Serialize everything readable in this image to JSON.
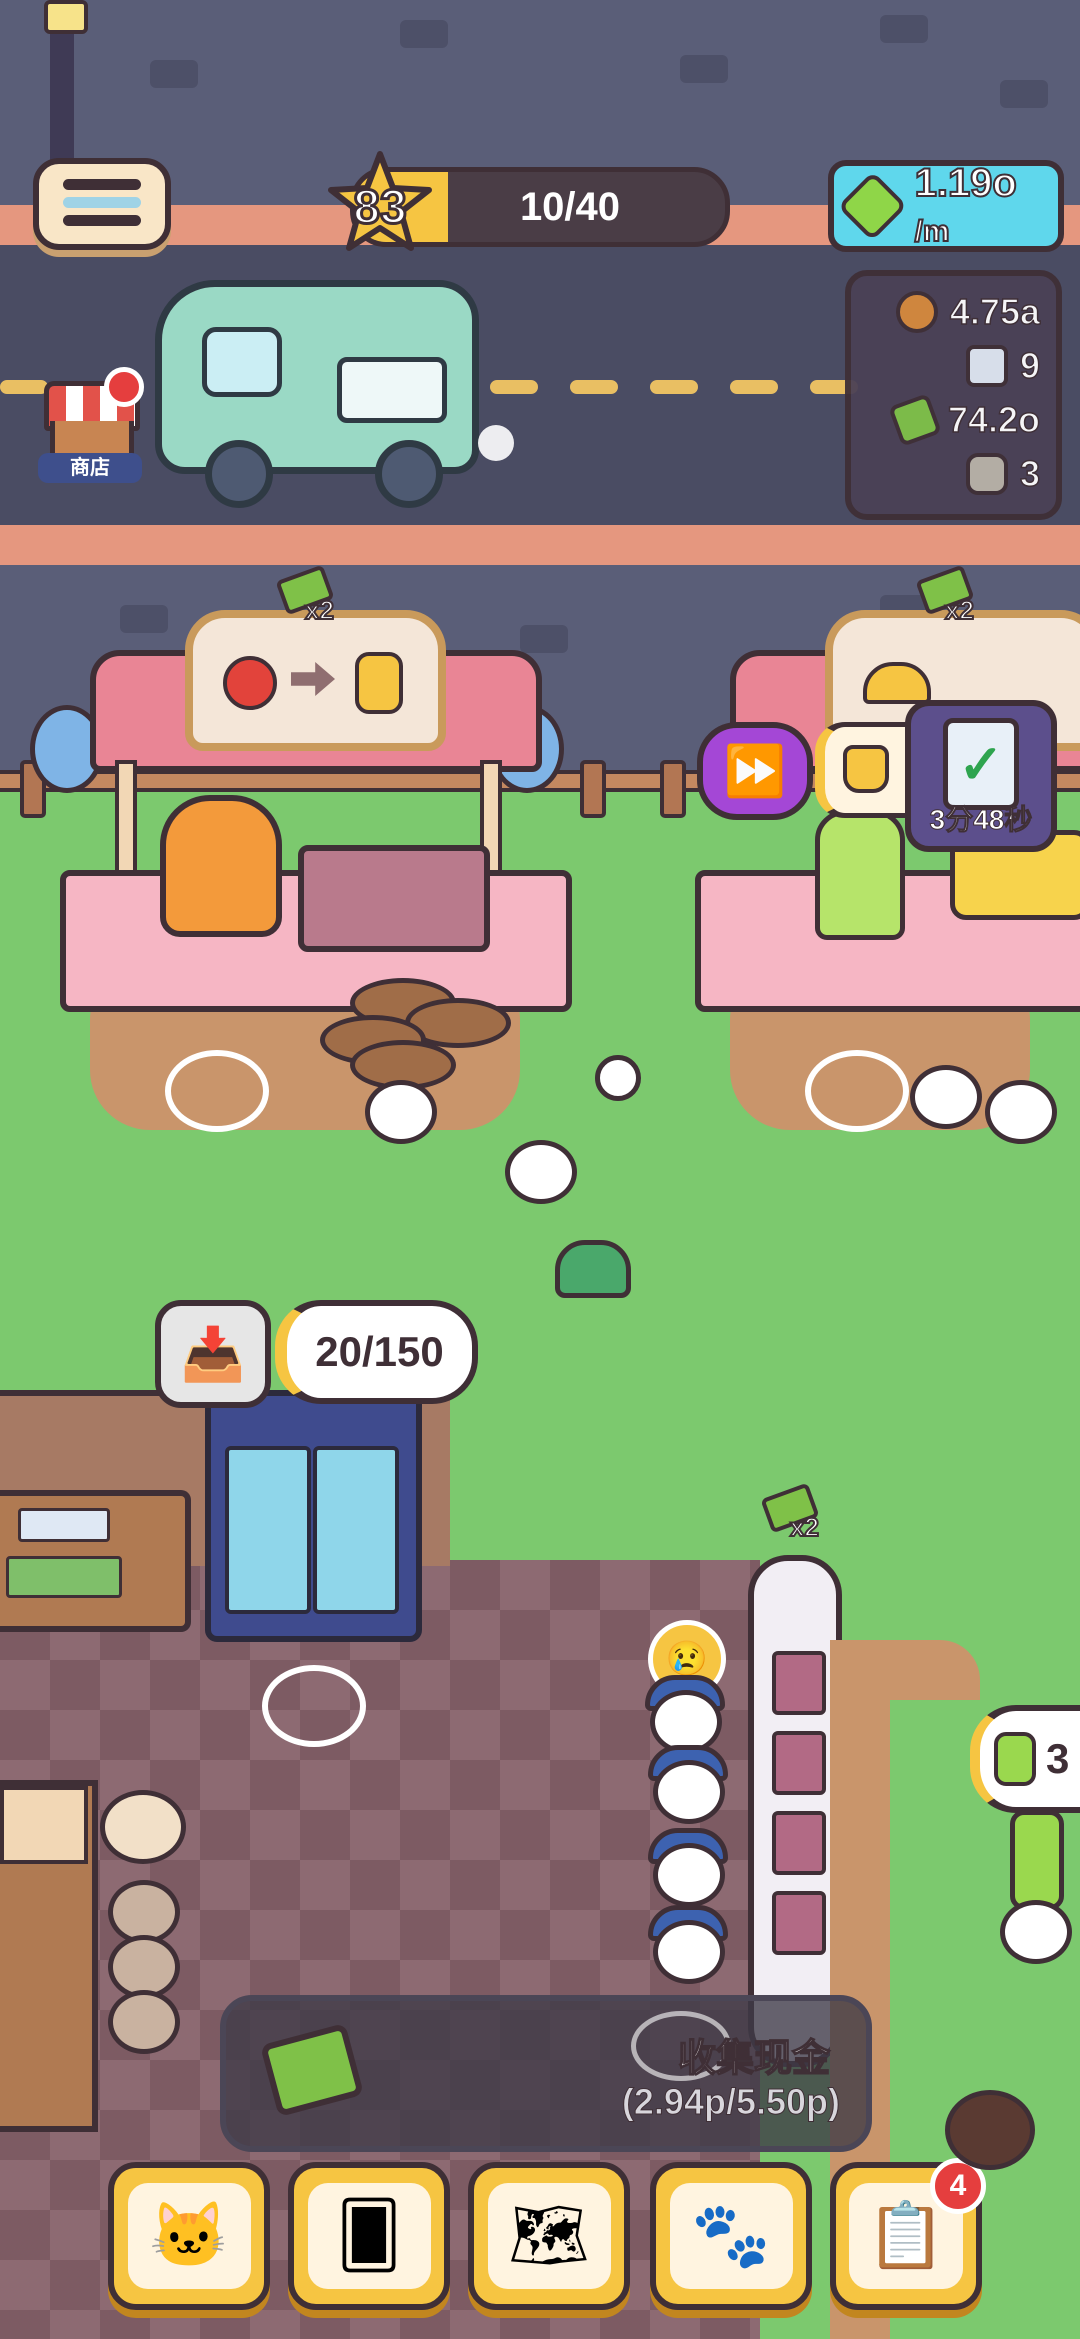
{
  "hud": {
    "level": "83",
    "level_progress_text": "10/40",
    "level_progress_fraction": 0.25,
    "income_rate": "1.19o",
    "income_unit": "/m",
    "shop_label": "商店"
  },
  "resources": [
    {
      "icon": "cookie-icon",
      "value": "4.75a",
      "color": "#d78a3d"
    },
    {
      "icon": "gem-icon",
      "value": "9",
      "color": "#dfe6f2"
    },
    {
      "icon": "cash-icon",
      "value": "74.2o",
      "color": "#7fc148"
    },
    {
      "icon": "stone-icon",
      "value": "3",
      "color": "#b9b3a8"
    }
  ],
  "stands": {
    "left_multiplier": "x2",
    "right_multiplier": "x2",
    "belt_multiplier": "x2",
    "timer_text": "3分48秒"
  },
  "storage": {
    "capacity_text": "20/150"
  },
  "right_tag": {
    "count": "3"
  },
  "collect": {
    "title": "收集现金",
    "rate": "(2.94p/5.50p)"
  },
  "bottom_nav": {
    "items": [
      {
        "name": "staff-nav-button",
        "icon": "chef-cat-icon",
        "glyph": "🐱"
      },
      {
        "name": "cards-nav-button",
        "icon": "cards-icon",
        "glyph": "🂠"
      },
      {
        "name": "map-nav-button",
        "icon": "map-icon",
        "glyph": "🗺"
      },
      {
        "name": "team-nav-button",
        "icon": "team-cats-icon",
        "glyph": "🐾"
      },
      {
        "name": "tasks-nav-button",
        "icon": "clipboard-icon",
        "glyph": "📋"
      }
    ],
    "tasks_badge": "4"
  },
  "colors": {
    "accent_yellow": "#f6c542",
    "outline": "#3f2f36",
    "grass": "#7cc96e",
    "road": "#4a4c63",
    "income_badge": "#5fd7ec",
    "fast_forward": "#a447d6"
  }
}
